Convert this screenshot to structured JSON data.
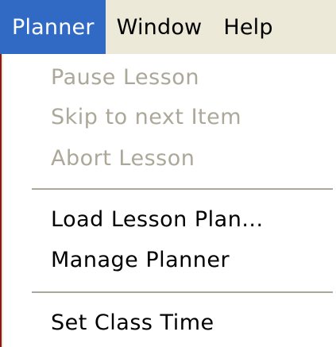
{
  "menubar": {
    "items": [
      {
        "label": "Planner",
        "active": true
      },
      {
        "label": "Window",
        "active": false
      },
      {
        "label": "Help",
        "active": false
      }
    ]
  },
  "dropdown": {
    "items": [
      {
        "label": "Pause Lesson",
        "enabled": false
      },
      {
        "label": "Skip to next Item",
        "enabled": false
      },
      {
        "label": "Abort Lesson",
        "enabled": false
      },
      {
        "label": "Load Lesson Plan...",
        "enabled": true
      },
      {
        "label": "Manage Planner",
        "enabled": true
      },
      {
        "label": "Set Class Time",
        "enabled": true
      }
    ]
  },
  "colors": {
    "highlight": "#316ac5",
    "menubar_bg": "#ece9d8",
    "disabled_text": "#aca899",
    "separator": "#aca899"
  }
}
